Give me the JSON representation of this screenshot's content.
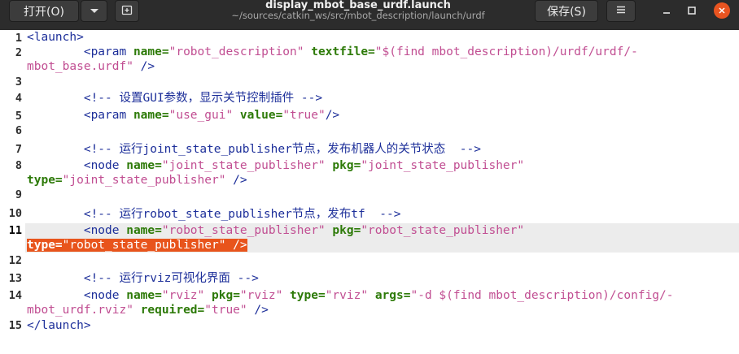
{
  "header": {
    "open_label": "打开(O)",
    "save_label": "保存(S)",
    "title": "display_mbot_base_urdf.launch",
    "subtitle": "~/sources/catkin_ws/src/mbot_description/launch/urdf"
  },
  "colors": {
    "accent": "#e95420",
    "headerbar": "#2c2c2c",
    "selection": "#e8541c",
    "current_line": "#ececec"
  },
  "icons": [
    "chevron-down-icon",
    "new-tab-icon",
    "hamburger-menu-icon",
    "minimize-icon",
    "maximize-icon",
    "close-icon"
  ],
  "line_numbers": [
    "1",
    "2",
    "3",
    "4",
    "5",
    "6",
    "7",
    "8",
    "9",
    "10",
    "11",
    "12",
    "13",
    "14",
    "15"
  ],
  "current_line": "11",
  "code": {
    "l1": "<launch>",
    "l2a_t": "        <param ",
    "l2a_a1": "name=",
    "l2a_v1": "\"robot_description\"",
    "l2a_a2": "textfile=",
    "l2a_v2": "\"$(find mbot_description)/urdf/urdf/-",
    "l2b_v": "mbot_base.urdf\"",
    "l2b_t": " />",
    "l4": "        <!-- 设置GUI参数，显示关节控制插件 -->",
    "l5_t": "        <param ",
    "l5_a1": "name=",
    "l5_v1": "\"use_gui\"",
    "l5_a2": "value=",
    "l5_v2": "\"true\"",
    "l5_e": "/>",
    "l7": "        <!-- 运行joint_state_publisher节点，发布机器人的关节状态  -->",
    "l8_t": "        <node ",
    "l8_a1": "name=",
    "l8_v1": "\"joint_state_publisher\"",
    "l8_a2": "pkg=",
    "l8_v2": "\"joint_state_publisher\"",
    "l8b_a": "type=",
    "l8b_v": "\"joint_state_publisher\"",
    "l8b_e": " />",
    "l10": "        <!-- 运行robot_state_publisher节点，发布tf  -->",
    "l11_t": "        <node ",
    "l11_a1": "name=",
    "l11_v1": "\"robot_state_publisher\"",
    "l11_a2": "pkg=",
    "l11_v2": "\"robot_state_publisher\"",
    "l11b_a": "type=",
    "l11b_v": "\"robot_state_publisher\"",
    "l11b_e": " />",
    "l13": "        <!-- 运行rviz可视化界面 -->",
    "l14_t": "        <node ",
    "l14_a1": "name=",
    "l14_v1": "\"rviz\"",
    "l14_a2": "pkg=",
    "l14_v2": "\"rviz\"",
    "l14_a3": "type=",
    "l14_v3": "\"rviz\"",
    "l14_a4": "args=",
    "l14_v4": "\"-d $(find mbot_description)/config/-",
    "l14b_v": "mbot_urdf.rviz\"",
    "l14b_a": "required=",
    "l14b_v2": "\"true\"",
    "l14b_e": " />",
    "l15": "</launch>"
  }
}
